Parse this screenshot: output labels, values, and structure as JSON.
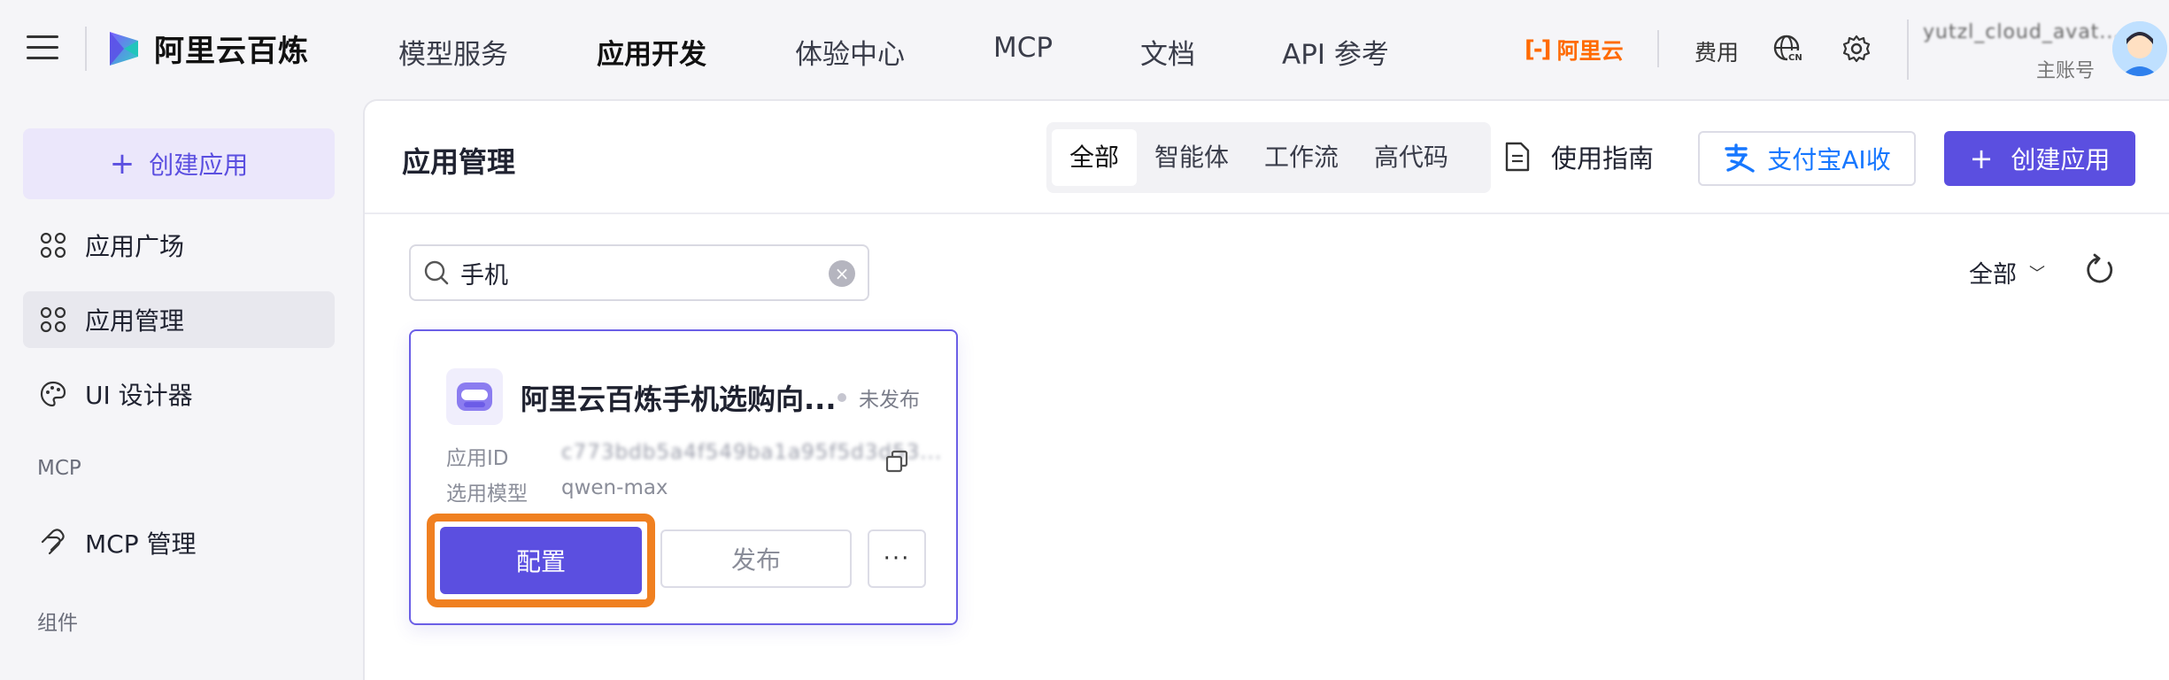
{
  "brand": {
    "name": "阿里云百炼"
  },
  "nav": [
    {
      "label": "模型服务",
      "active": false
    },
    {
      "label": "应用开发",
      "active": true
    },
    {
      "label": "体验中心",
      "active": false
    },
    {
      "label": "MCP",
      "active": false
    },
    {
      "label": "文档",
      "active": false
    },
    {
      "label": "API 参考",
      "active": false
    }
  ],
  "topbar": {
    "aliyun_label": "阿里云",
    "fee_label": "费用",
    "username": "yutzl_cloud_avat...",
    "account_type": "主账号",
    "icons": [
      "language-cn-icon",
      "settings-gear-icon"
    ]
  },
  "sidebar": {
    "create_label": "创建应用",
    "items": [
      {
        "label": "应用广场",
        "icon": "grid-apps-icon",
        "active": false
      },
      {
        "label": "应用管理",
        "icon": "grid-apps-icon",
        "active": true
      },
      {
        "label": "UI 设计器",
        "icon": "palette-icon",
        "active": false
      }
    ],
    "group_mcp": "MCP",
    "mcp_items": [
      {
        "label": "MCP 管理",
        "icon": "mcp-icon"
      }
    ],
    "group_components": "组件"
  },
  "main": {
    "title": "应用管理",
    "tabs": [
      {
        "label": "全部",
        "active": true
      },
      {
        "label": "智能体",
        "active": false
      },
      {
        "label": "工作流",
        "active": false
      },
      {
        "label": "高代码",
        "active": false
      }
    ],
    "guide_label": "使用指南",
    "alipay_label": "支付宝AI收",
    "create_label": "创建应用",
    "search": {
      "value": "手机"
    },
    "filter_label": "全部"
  },
  "card": {
    "title": "阿里云百炼手机选购向...",
    "status": "未发布",
    "app_id_label": "应用ID",
    "app_id_value": "c773bdb5a4f549ba1a95f5d3d53...",
    "model_label": "选用模型",
    "model_value": "qwen-max",
    "config_label": "配置",
    "publish_label": "发布",
    "more_label": "···"
  },
  "colors": {
    "accent": "#5b4fe0",
    "highlight": "#f08020",
    "aliyun_orange": "#ff6a00",
    "alipay_blue": "#1677ff"
  }
}
